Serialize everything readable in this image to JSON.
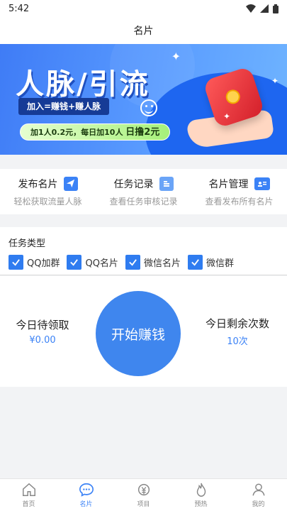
{
  "status_bar": {
    "time": "5:42"
  },
  "header": {
    "title": "名片"
  },
  "banner": {
    "title": "人脉/引流",
    "subtitle": "加入=赚钱+赚人脉",
    "pill_text": "加1人0.2元，每日加10人",
    "pill_highlight": "日撸2元"
  },
  "actions": [
    {
      "label": "发布名片",
      "sub": "轻松获取流量人脉",
      "icon": "send-icon"
    },
    {
      "label": "任务记录",
      "sub": "查看任务审核记录",
      "icon": "list-icon"
    },
    {
      "label": "名片管理",
      "sub": "查看发布所有名片",
      "icon": "card-icon"
    }
  ],
  "task_types": {
    "title": "任务类型",
    "options": [
      {
        "label": "QQ加群",
        "checked": true
      },
      {
        "label": "QQ名片",
        "checked": true
      },
      {
        "label": "微信名片",
        "checked": true
      },
      {
        "label": "微信群",
        "checked": true
      }
    ]
  },
  "earn": {
    "left_label": "今日待领取",
    "left_value": "¥0.00",
    "button": "开始赚钱",
    "right_label": "今日剩余次数",
    "right_value": "10次"
  },
  "tabbar": [
    {
      "label": "首页",
      "icon": "home-icon",
      "active": false
    },
    {
      "label": "名片",
      "icon": "chat-icon",
      "active": true
    },
    {
      "label": "项目",
      "icon": "money-icon",
      "active": false
    },
    {
      "label": "预热",
      "icon": "fire-icon",
      "active": false
    },
    {
      "label": "我的",
      "icon": "user-icon",
      "active": false
    }
  ],
  "colors": {
    "accent": "#3b82f6",
    "button": "#3f86ee"
  }
}
